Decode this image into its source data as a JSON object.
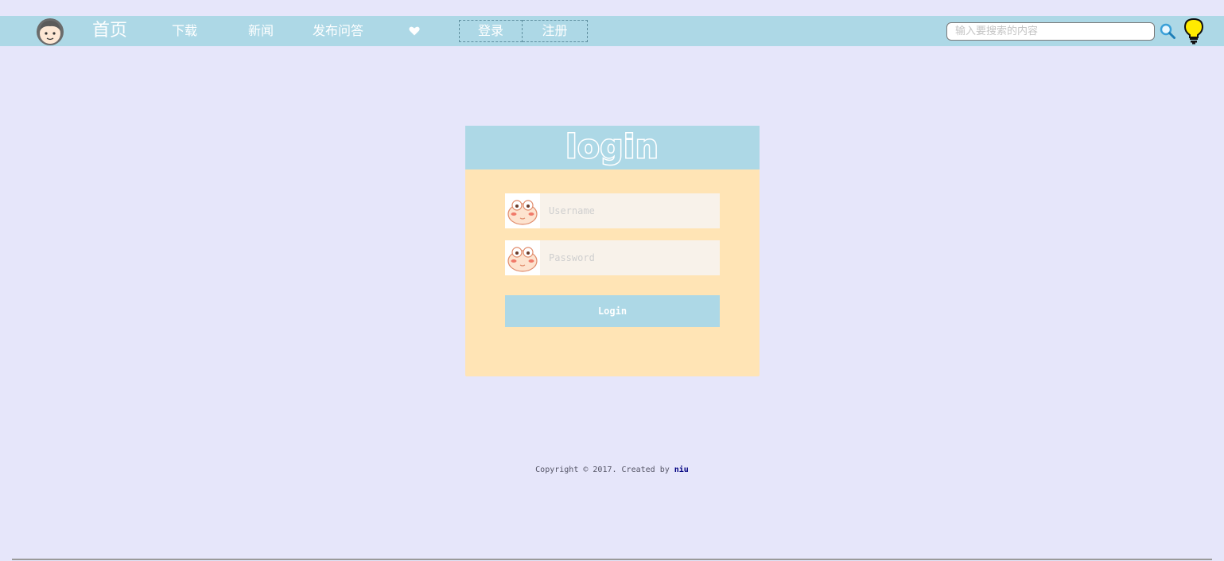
{
  "nav": {
    "home": "首页",
    "download": "下载",
    "news": "新闻",
    "ask": "发布问答",
    "login": "登录",
    "register": "注册",
    "heart_icon": "heart-icon",
    "avatar_icon": "boy-avatar-icon"
  },
  "search": {
    "placeholder": "输入要搜索的内容",
    "value": "",
    "icon": "search-icon"
  },
  "bulb_icon": "lightbulb-icon",
  "login_form": {
    "title": "login",
    "username_placeholder": "Username",
    "password_placeholder": "Password",
    "field_icon": "frog-face-icon",
    "submit_label": "Login"
  },
  "footer": {
    "copyright": "Copyright © 2017. Created by ",
    "author": "niu"
  },
  "colors": {
    "page_bg": "#e6e6fa",
    "nav_bg": "#add8e6",
    "panel_bg": "#ffe4b5",
    "field_bg": "#f8f2ea",
    "author_link": "#000080"
  }
}
